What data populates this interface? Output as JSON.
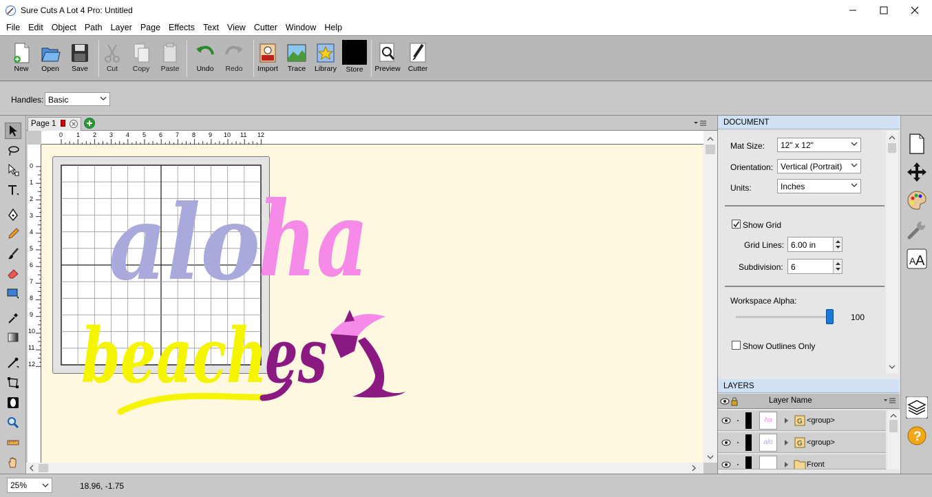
{
  "window": {
    "title": "Sure Cuts A Lot 4 Pro: Untitled"
  },
  "menu": [
    "File",
    "Edit",
    "Object",
    "Path",
    "Layer",
    "Page",
    "Effects",
    "Text",
    "View",
    "Cutter",
    "Window",
    "Help"
  ],
  "toolbar": {
    "new": "New",
    "open": "Open",
    "save": "Save",
    "cut": "Cut",
    "copy": "Copy",
    "paste": "Paste",
    "undo": "Undo",
    "redo": "Redo",
    "import": "Import",
    "trace": "Trace",
    "library": "Library",
    "store": "Store",
    "preview": "Preview",
    "cutter": "Cutter"
  },
  "options": {
    "handles_label": "Handles:",
    "handles_value": "Basic"
  },
  "tabs": {
    "page1": "Page 1"
  },
  "ruler": {
    "top": [
      "0",
      "1",
      "2",
      "3",
      "4",
      "5",
      "6",
      "7",
      "8",
      "9",
      "10",
      "11",
      "12"
    ],
    "left": [
      "0",
      "1",
      "2",
      "3",
      "4",
      "5",
      "6",
      "7",
      "8",
      "9",
      "10",
      "11",
      "12"
    ]
  },
  "artwork": {
    "aloha_left": "alo",
    "aloha_right": "ha",
    "beaches_left": "beach",
    "beaches_right": "es"
  },
  "document": {
    "header": "DOCUMENT",
    "mat_size_label": "Mat Size:",
    "mat_size_value": "12\" x 12\"",
    "orientation_label": "Orientation:",
    "orientation_value": "Vertical (Portrait)",
    "units_label": "Units:",
    "units_value": "Inches",
    "show_grid_label": "Show Grid",
    "show_grid_checked": true,
    "grid_lines_label": "Grid Lines:",
    "grid_lines_value": "6.00 in",
    "subdivision_label": "Subdivision:",
    "subdivision_value": "6",
    "alpha_label": "Workspace Alpha:",
    "alpha_value": "100",
    "alpha_fraction": 1.0,
    "outlines_label": "Show Outlines Only",
    "outlines_checked": false
  },
  "layers": {
    "header": "LAYERS",
    "col_name": "Layer Name",
    "rows": [
      {
        "name": "<group>"
      },
      {
        "name": "<group>"
      },
      {
        "name": "Front"
      }
    ]
  },
  "status": {
    "zoom": "25%",
    "coords": "18.96, -1.75"
  },
  "colors": {
    "lavender": "#a9a9dc",
    "pink": "#f58ae8",
    "yellow": "#f6f500",
    "purple": "#8a1a82",
    "workspace": "#fff8e0",
    "toolbar_bg": "#b8b8b8",
    "panel_header": "#cfe1f3"
  }
}
